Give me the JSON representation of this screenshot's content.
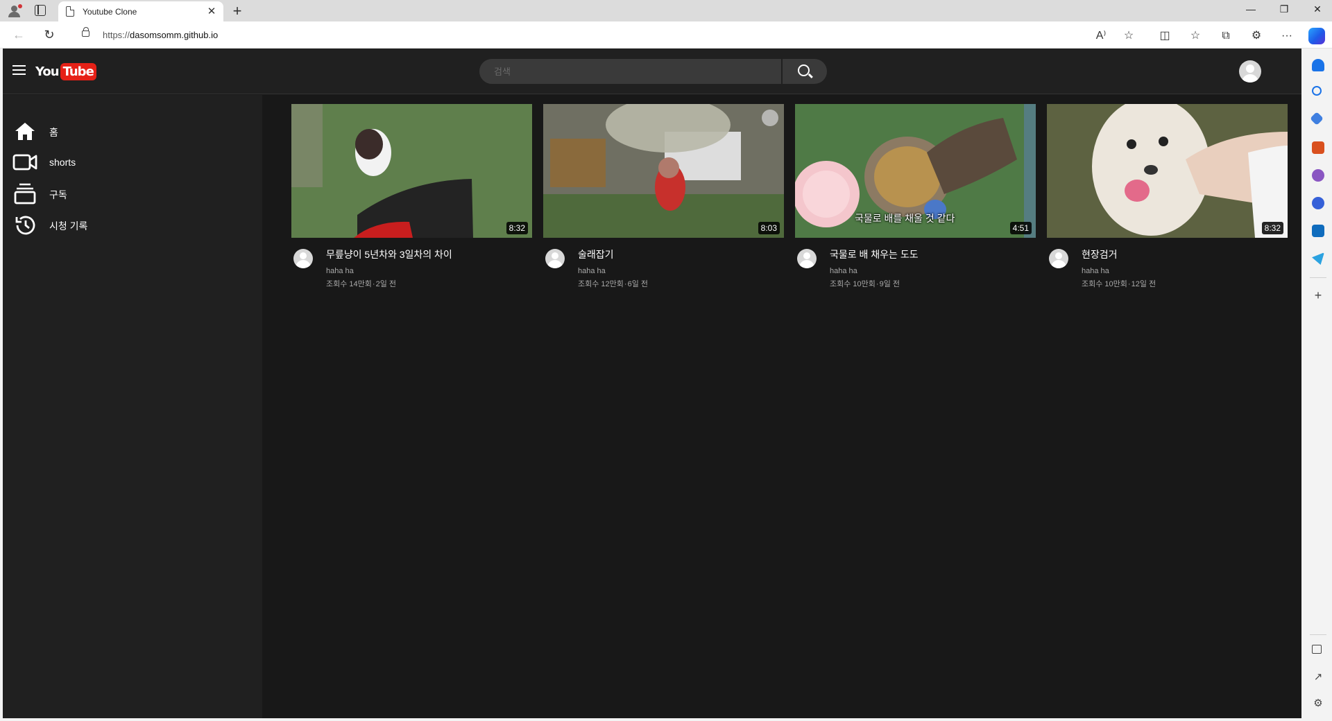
{
  "browser": {
    "tab_title": "Youtube Clone",
    "tab_close": "✕",
    "new_tab": "+",
    "url_protocol": "https://",
    "url_host": "dasomsomm.github.io",
    "window": {
      "minimize": "—",
      "restore": "❐",
      "close": "✕"
    },
    "toolbar": {
      "read_aloud": "A⁾",
      "favorite": "☆",
      "split": "◫",
      "favorites": "☆",
      "collections": "⧉",
      "extensions": "⚙",
      "more": "···"
    }
  },
  "header": {
    "logo_you": "You",
    "logo_tube": "Tube",
    "search_placeholder": "검색"
  },
  "sidebar": {
    "items": [
      {
        "label": "홈",
        "icon": "home-icon"
      },
      {
        "label": "shorts",
        "icon": "video-camera-icon"
      },
      {
        "label": "구독",
        "icon": "subscriptions-icon"
      },
      {
        "label": "시청 기록",
        "icon": "history-icon"
      }
    ]
  },
  "videos": [
    {
      "title": "무릎냥이 5년차와 3일차의 차이",
      "channel": "haha ha",
      "views": "조회수 14만회",
      "age": "2일 전",
      "duration": "8:32",
      "caption": ""
    },
    {
      "title": "술래잡기",
      "channel": "haha ha",
      "views": "조회수 12만회",
      "age": "6일 전",
      "duration": "8:03",
      "caption": ""
    },
    {
      "title": "국물로 배 채우는 도도",
      "channel": "haha ha",
      "views": "조회수 10만회",
      "age": "9일 전",
      "duration": "4:51",
      "caption": "국물로 배를 채울 것 같다"
    },
    {
      "title": "현장검거",
      "channel": "haha ha",
      "views": "조회수 10만회",
      "age": "12일 전",
      "duration": "8:32",
      "caption": ""
    }
  ],
  "colors": {
    "page_bg": "#181818",
    "header_bg": "#202020",
    "sidebar_bg": "#202020",
    "logo_red": "#e62117",
    "search_bg": "#3a3a3a",
    "secondary_text": "#aaaaaa"
  }
}
